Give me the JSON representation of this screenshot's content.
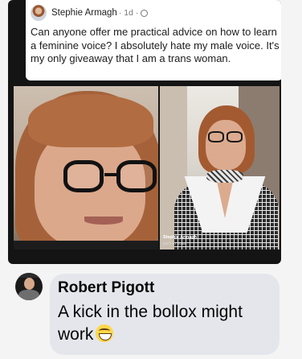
{
  "post": {
    "author": "Stephie Armagh",
    "time": "· 1d ·",
    "privacy_icon": "globe-icon",
    "text": "Can anyone offer me practical advice on how to learn a feminine voice? I absolutely hate my male voice. It's my only giveaway that I am a trans woman.",
    "photo_watermark_name": "Stephie Armagh",
    "photo_watermark_sub": "EDIT AT 2048"
  },
  "comment": {
    "author": "Robert Pigott",
    "text": "A kick in the bollox might work",
    "emoji": "grinning-face-icon"
  },
  "colors": {
    "post_background": "#141414",
    "post_card": "#ffffff",
    "comment_bubble": "#e4e6eb",
    "page_background": "#f4f4f4"
  }
}
